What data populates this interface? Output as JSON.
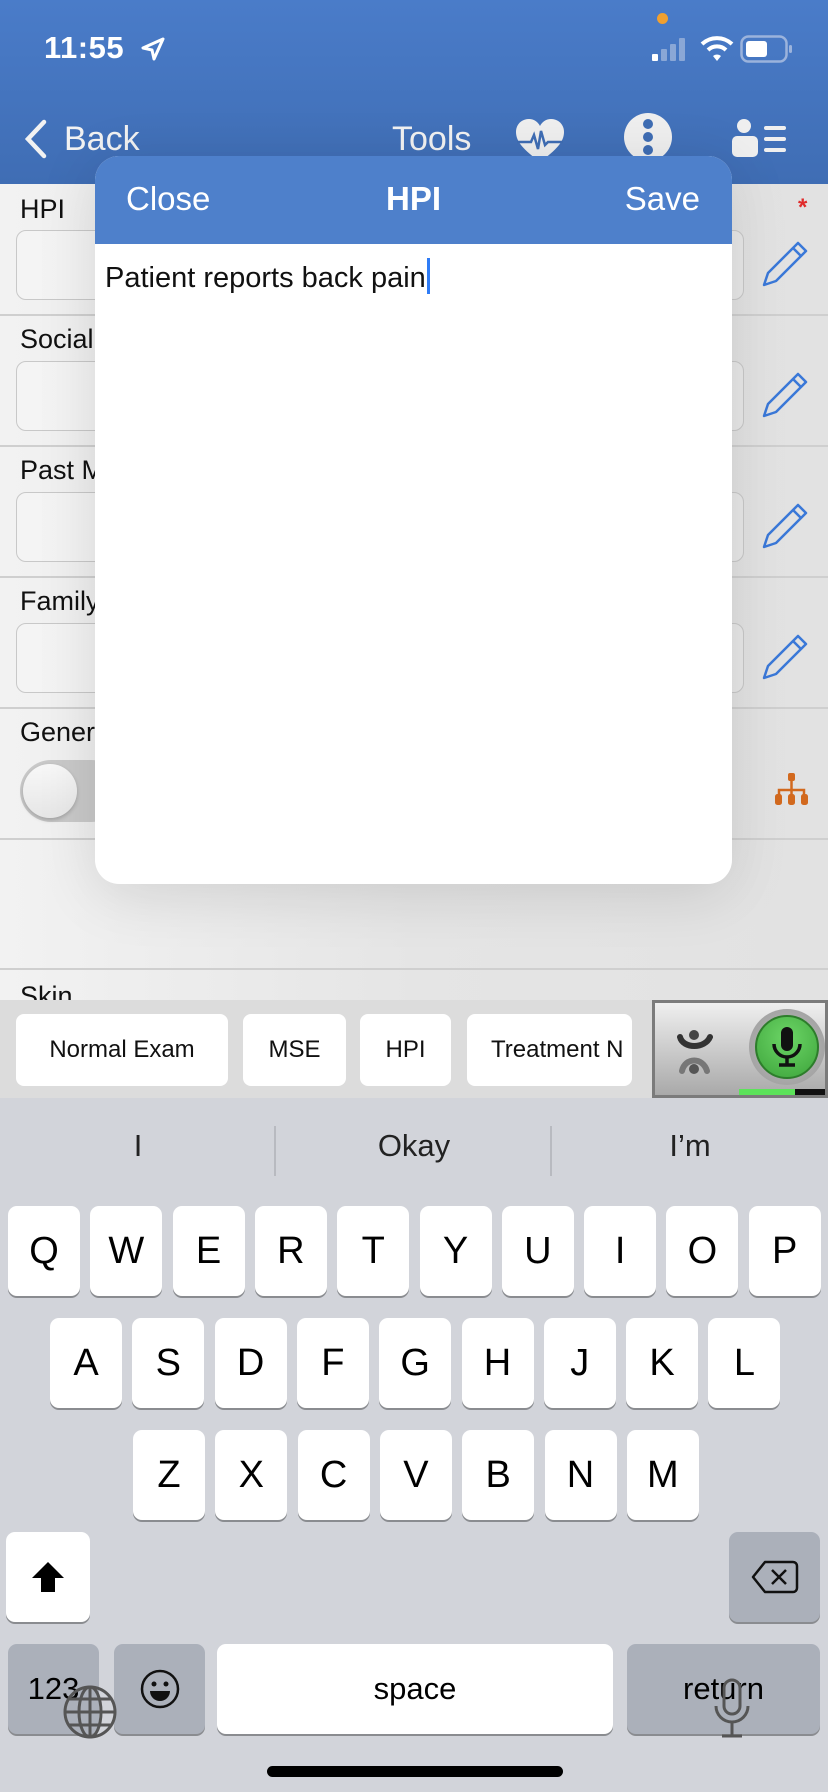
{
  "status_bar": {
    "time": "11:55",
    "location_icon": "location-arrow-icon",
    "signal_icon": "cellular-signal-icon",
    "wifi_icon": "wifi-icon",
    "battery_icon": "battery-icon",
    "privacy_dot_color": "#f0a030"
  },
  "nav": {
    "back_label": "Back",
    "tools_label": "Tools",
    "icons": [
      "heart-monitor-icon",
      "more-vertical-icon",
      "patient-list-icon"
    ],
    "bar_color": "#4578c4"
  },
  "form": {
    "rows": [
      {
        "label": "HPI",
        "required": true,
        "required_mark": "*"
      },
      {
        "label": "Social",
        "required": false
      },
      {
        "label": "Past M",
        "required": false
      },
      {
        "label": "Family",
        "required": false
      },
      {
        "label": "Gener",
        "type": "toggle",
        "toggle_on": false
      }
    ],
    "next_label": "Skin"
  },
  "modal": {
    "close_label": "Close",
    "title": "HPI",
    "save_label": "Save",
    "text_value": "Patient reports back pain",
    "header_color": "#4e80cb"
  },
  "quick_bar": {
    "buttons": [
      "Normal Exam",
      "MSE",
      "HPI",
      "Treatment N"
    ],
    "dictation": {
      "logo_icon": "dragon-logo-icon",
      "mic_icon": "microphone-icon",
      "mic_color": "#4cb749",
      "level": 0.65
    }
  },
  "keyboard": {
    "suggestions": [
      "I",
      "Okay",
      "I’m"
    ],
    "row1": [
      "Q",
      "W",
      "E",
      "R",
      "T",
      "Y",
      "U",
      "I",
      "O",
      "P"
    ],
    "row2": [
      "A",
      "S",
      "D",
      "F",
      "G",
      "H",
      "J",
      "K",
      "L"
    ],
    "row3": [
      "Z",
      "X",
      "C",
      "V",
      "B",
      "N",
      "M"
    ],
    "numbers_label": "123",
    "space_label": "space",
    "return_label": "return"
  }
}
